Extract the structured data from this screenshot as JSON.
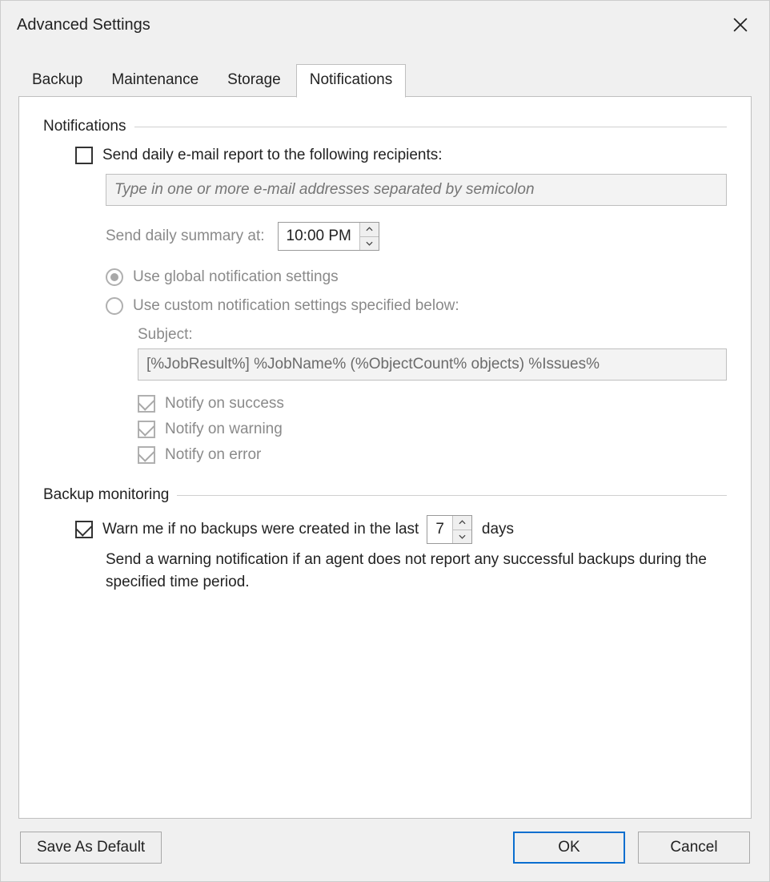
{
  "window": {
    "title": "Advanced Settings"
  },
  "tabs": {
    "backup": "Backup",
    "maintenance": "Maintenance",
    "storage": "Storage",
    "notifications": "Notifications"
  },
  "notifications_group": {
    "legend": "Notifications",
    "send_daily_label": "Send daily e-mail report to the following recipients:",
    "recipients_placeholder": "Type in one or more e-mail addresses separated by semicolon",
    "recipients_value": "",
    "summary_label": "Send daily summary at:",
    "summary_time": "10:00 PM",
    "radio_global": "Use global notification settings",
    "radio_custom": "Use custom notification settings specified below:",
    "subject_label": "Subject:",
    "subject_value": "[%JobResult%] %JobName% (%ObjectCount% objects) %Issues%",
    "notify_success": "Notify on success",
    "notify_warning": "Notify on warning",
    "notify_error": "Notify on error"
  },
  "monitoring_group": {
    "legend": "Backup monitoring",
    "warn_label_pre": "Warn me if no backups were created in the last",
    "warn_days": "7",
    "warn_label_post": "days",
    "desc": "Send a warning notification if an agent does not report any successful backups during the specified time period."
  },
  "buttons": {
    "save_default": "Save As Default",
    "ok": "OK",
    "cancel": "Cancel"
  }
}
